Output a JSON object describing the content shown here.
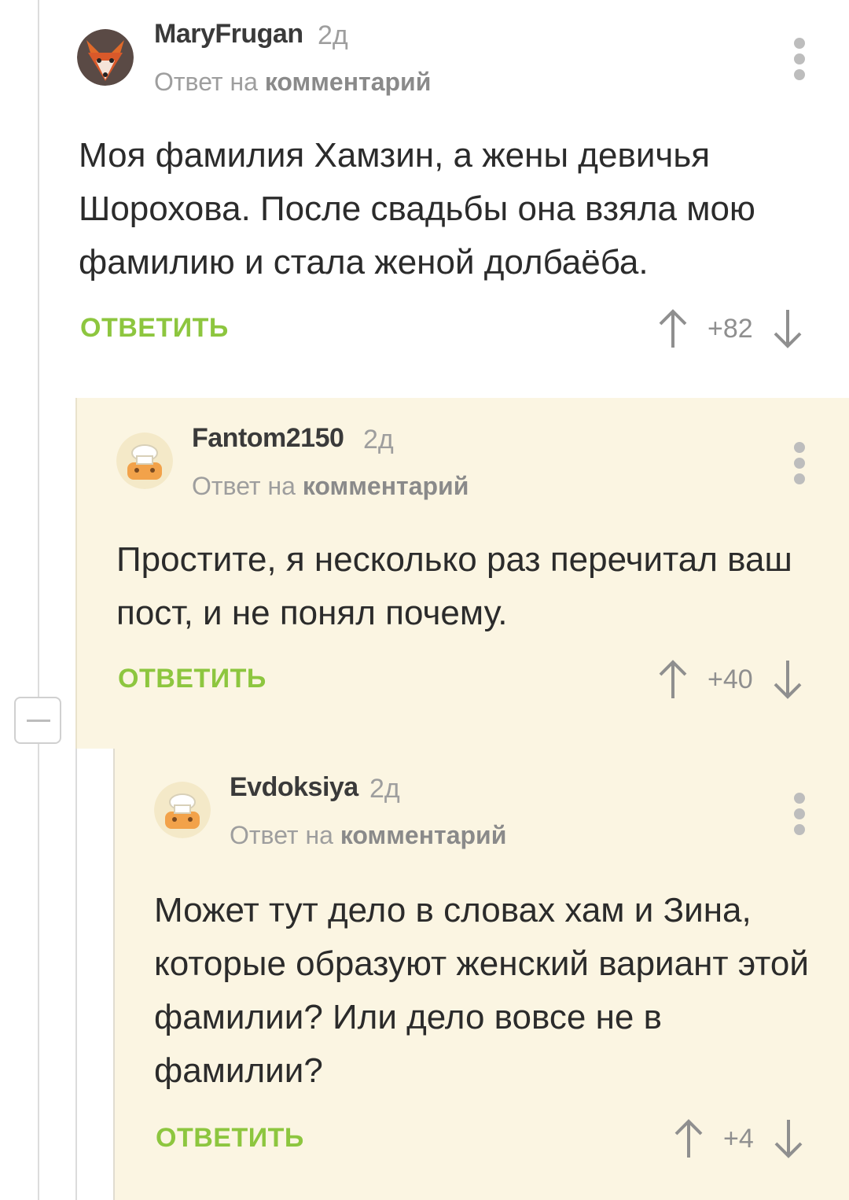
{
  "comments": [
    {
      "username": "MaryFrugan",
      "time": "2д",
      "reply_prefix": "Ответ на",
      "reply_link": "комментарий",
      "text": "Моя фамилия Хамзин, а жены девичья Шорохова. После свадьбы она взяла мою фамилию и стала женой долбаёба.",
      "reply_label": "ОТВЕТИТЬ",
      "score": "+82",
      "avatar": "fox-avatar"
    },
    {
      "username": "Fantom2150",
      "time": "2д",
      "reply_prefix": "Ответ на",
      "reply_link": "комментарий",
      "text": "Простите, я несколько раз перечитал ваш пост, и не понял почему.",
      "reply_label": "ОТВЕТИТЬ",
      "score": "+40",
      "avatar": "default-chef-avatar"
    },
    {
      "username": "Evdoksiya",
      "time": "2д",
      "reply_prefix": "Ответ на",
      "reply_link": "комментарий",
      "text": "Может тут дело в словах хам и Зина, которые образуют женский вариант этой фамилии? Или дело вовсе не в фамилии?",
      "reply_label": "ОТВЕТИТЬ",
      "score": "+4",
      "avatar": "default-chef-avatar"
    }
  ],
  "colors": {
    "reply_green": "#8dc63f",
    "nested_bg": "#fbf5e2",
    "muted_text": "#9e9e9e"
  }
}
